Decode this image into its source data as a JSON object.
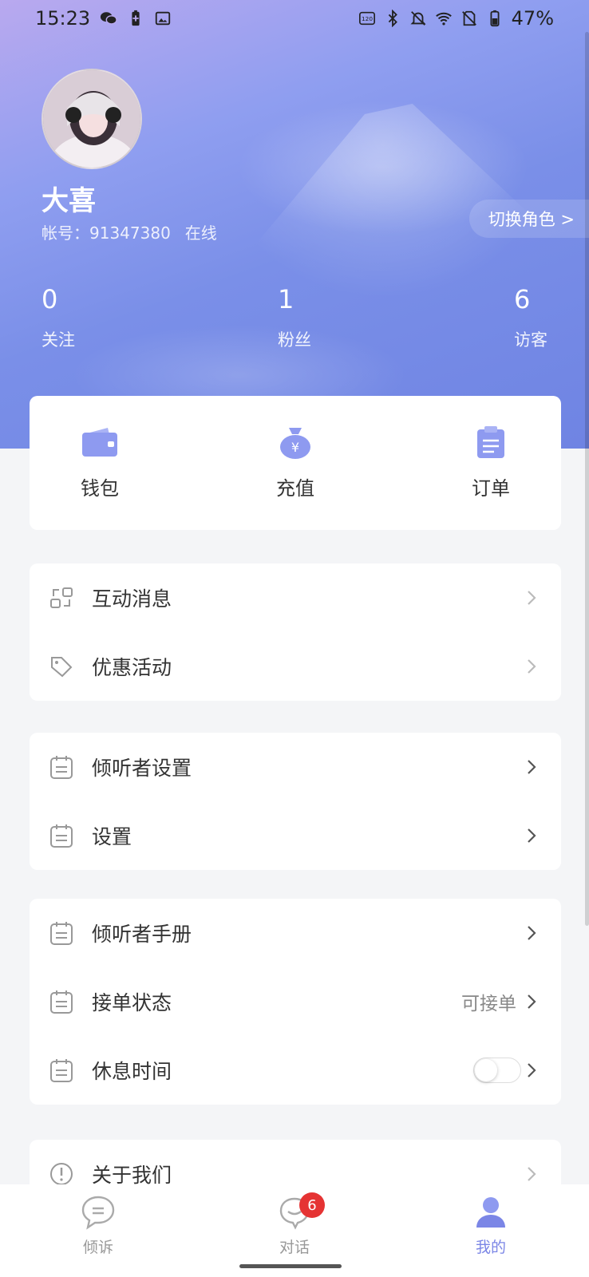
{
  "status_bar": {
    "time": "15:23",
    "battery": "47%"
  },
  "profile": {
    "name": "大喜",
    "account_label": "帐号：91347380",
    "online_status": "在线",
    "switch_role": "切换角色 >"
  },
  "stats": [
    {
      "value": "0",
      "label": "关注"
    },
    {
      "value": "1",
      "label": "粉丝"
    },
    {
      "value": "6",
      "label": "访客"
    }
  ],
  "quick_actions": [
    {
      "label": "钱包",
      "icon": "wallet-icon"
    },
    {
      "label": "充值",
      "icon": "money-bag-icon"
    },
    {
      "label": "订单",
      "icon": "clipboard-icon"
    }
  ],
  "menu_group_1": [
    {
      "label": "互动消息",
      "icon": "interaction-icon"
    },
    {
      "label": "优惠活动",
      "icon": "tag-icon"
    }
  ],
  "menu_group_2": [
    {
      "label": "倾听者设置",
      "icon": "calendar-icon"
    },
    {
      "label": "设置",
      "icon": "calendar-icon"
    }
  ],
  "menu_group_3": [
    {
      "label": "倾听者手册",
      "icon": "calendar-icon"
    },
    {
      "label": "接单状态",
      "icon": "calendar-icon",
      "value": "可接单"
    },
    {
      "label": "休息时间",
      "icon": "calendar-icon",
      "toggle": false
    }
  ],
  "menu_group_4": [
    {
      "label": "关于我们",
      "icon": "info-icon"
    }
  ],
  "tabbar": {
    "tabs": [
      {
        "label": "倾诉",
        "icon": "chat-bubble-icon"
      },
      {
        "label": "对话",
        "icon": "dialog-icon",
        "badge": "6"
      },
      {
        "label": "我的",
        "icon": "person-icon",
        "active": true
      }
    ]
  },
  "colors": {
    "accent": "#7b86e6",
    "badge": "#e53333",
    "icon_fill": "#8e9af0"
  }
}
